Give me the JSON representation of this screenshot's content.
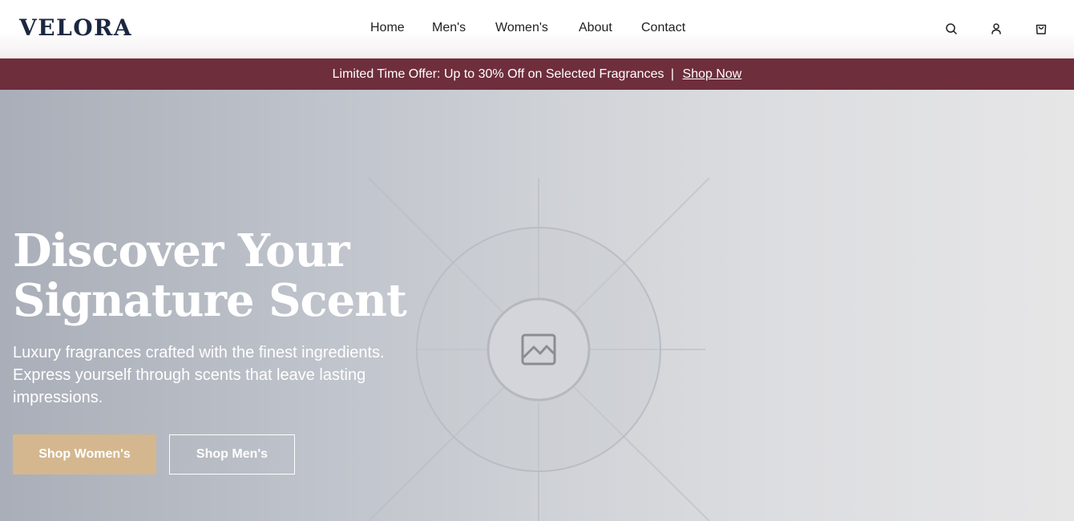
{
  "brand": {
    "name": "VELORA"
  },
  "nav": {
    "items": [
      {
        "label": "Home"
      },
      {
        "label": "Men's"
      },
      {
        "label": "Women's"
      },
      {
        "label": "About"
      },
      {
        "label": "Contact"
      }
    ]
  },
  "header_icons": [
    "search-icon",
    "user-icon",
    "shopping-bag-icon"
  ],
  "promo": {
    "text": "Limited Time Offer: Up to 30% Off on Selected Fragrances",
    "separator": "|",
    "link_label": "Shop Now"
  },
  "hero": {
    "title_line1": "Discover Your",
    "title_line2": "Signature Scent",
    "subtitle": "Luxury fragrances crafted with the finest ingredients. Express yourself through scents that leave lasting impressions.",
    "buttons": {
      "primary_label": "Shop Women's",
      "secondary_label": "Shop Men's"
    },
    "image_placeholder_icon": "image-icon"
  },
  "colors": {
    "brand_navy": "#1b2742",
    "promo_bg": "#6e2e3c",
    "primary_button": "#d4b78e",
    "white": "#ffffff"
  }
}
